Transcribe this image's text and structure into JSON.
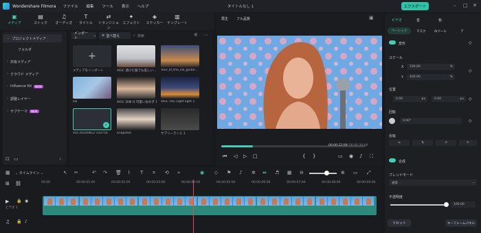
{
  "app": {
    "name": "Wondershare Filmora",
    "menu": [
      "ファイル",
      "編集",
      "ツール",
      "表示",
      "ヘルプ"
    ],
    "doc_title": "タイトルなし 1",
    "export_label": "エクスポート"
  },
  "toolbar": {
    "items": [
      {
        "label": "メディア",
        "icon": "media-icon"
      },
      {
        "label": "ストック",
        "icon": "stock-icon"
      },
      {
        "label": "オーディオ",
        "icon": "audio-icon"
      },
      {
        "label": "タイトル",
        "icon": "title-icon"
      },
      {
        "label": "トランジション",
        "icon": "transition-icon"
      },
      {
        "label": "エフェクト",
        "icon": "effect-icon"
      },
      {
        "label": "ステッカー",
        "icon": "sticker-icon"
      },
      {
        "label": "テンプレート",
        "icon": "template-icon"
      }
    ]
  },
  "sidebar": {
    "items": [
      {
        "label": "プロジェクトメディア"
      },
      {
        "label": "フォルダ"
      },
      {
        "label": "共有メディア"
      },
      {
        "label": "クラウド メディア"
      },
      {
        "label": "Influence Kit",
        "badge": "NEW"
      },
      {
        "label": "調整レイヤー"
      },
      {
        "label": "サブテーマ",
        "badge": "NEW"
      }
    ]
  },
  "media": {
    "import_label": "インポート",
    "sort_label": "並べ替え",
    "search_placeholder": "検索",
    "items": [
      {
        "caption": "メディアをインポート"
      },
      {
        "caption": "AIGC 透けた服でも美しい..."
      },
      {
        "caption": "Tour_of_the_cal_guitar..."
      },
      {
        "caption": "sal"
      },
      {
        "caption": "AIGC 日本 Q 可愛い女の子 1"
      },
      {
        "caption": "AIGC city night light 1"
      },
      {
        "caption": "VID 20240812 150756"
      },
      {
        "caption": "Snapshot"
      },
      {
        "caption": "サプリーランス 1"
      }
    ]
  },
  "preview": {
    "label_a": "再生",
    "label_b": "フル品質",
    "time": "00:00:22:00",
    "total": "/ 00:00:30:00",
    "progress": 0.22
  },
  "props": {
    "tabs": [
      "ビデオ",
      "音",
      "色"
    ],
    "subtabs": [
      "ベーシック",
      "マスク",
      "AIツール",
      "ア"
    ],
    "section_transform": "変形",
    "scale_label": "スケール",
    "x_label": "X",
    "x_value": "100.00",
    "y_label": "Y",
    "y_value": "100.00",
    "position_label": "位置",
    "px_value": "0.00",
    "py_value": "0.00",
    "rotate_label": "回転",
    "rotate_value": "0.00°",
    "flip_label": "反転",
    "section_composite": "合成",
    "blend_label": "ブレンドモード",
    "blend_value": "通常",
    "opacity_label": "不透明度",
    "opacity_value": "100.00",
    "reset_label": "リセット",
    "keyframe_label": "キーフレームパネル",
    "unit": "%",
    "unit_px": "px"
  },
  "timeline": {
    "ticks": [
      "00:00",
      "00:00:01:00",
      "00:00:02:00",
      "00:00:03:00",
      "00:00:04:00",
      "00:00:05:00",
      "00:00:06:00",
      "00:00:07:00",
      "00:00:08:00",
      "00:00:09:00"
    ],
    "track_label": "ビデオ 1",
    "playhead": 0.48
  }
}
